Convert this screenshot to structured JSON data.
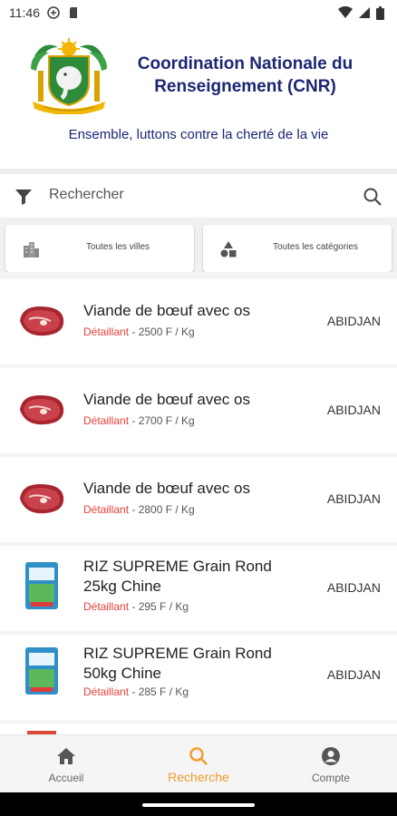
{
  "status_bar": {
    "time": "11:46"
  },
  "header": {
    "title_line1": "Coordination Nationale du",
    "title_line2": "Renseignement (CNR)",
    "slogan": "Ensemble, luttons contre la cherté de la vie"
  },
  "search": {
    "placeholder": "Rechercher"
  },
  "filters": {
    "cities_label": "Toutes les villes",
    "categories_label": "Toutes les catégories"
  },
  "items": [
    {
      "name_line1": "Viande de bœuf avec os",
      "name_line2": "",
      "seller": "Détaillant",
      "price": " - 2500 F / Kg",
      "city": "ABIDJAN",
      "image": "beef-icon"
    },
    {
      "name_line1": "Viande de bœuf avec os",
      "name_line2": "",
      "seller": "Détaillant",
      "price": " - 2700 F / Kg",
      "city": "ABIDJAN",
      "image": "beef-icon"
    },
    {
      "name_line1": "Viande de bœuf avec os",
      "name_line2": "",
      "seller": "Détaillant",
      "price": " - 2800 F / Kg",
      "city": "ABIDJAN",
      "image": "beef-icon"
    },
    {
      "name_line1": "RIZ SUPREME Grain Rond",
      "name_line2": "25kg Chine",
      "seller": "Détaillant",
      "price": " - 295 F / Kg",
      "city": "ABIDJAN",
      "image": "rice-bag-icon"
    },
    {
      "name_line1": "RIZ SUPREME Grain Rond",
      "name_line2": "50kg Chine",
      "seller": "Détaillant",
      "price": " - 285 F / Kg",
      "city": "ABIDJAN",
      "image": "rice-bag-icon"
    }
  ],
  "nav": {
    "home": "Accueil",
    "search": "Recherche",
    "account": "Compte"
  },
  "colors": {
    "title": "#1c2673",
    "seller": "#e5413a",
    "active": "#f39c2b"
  }
}
